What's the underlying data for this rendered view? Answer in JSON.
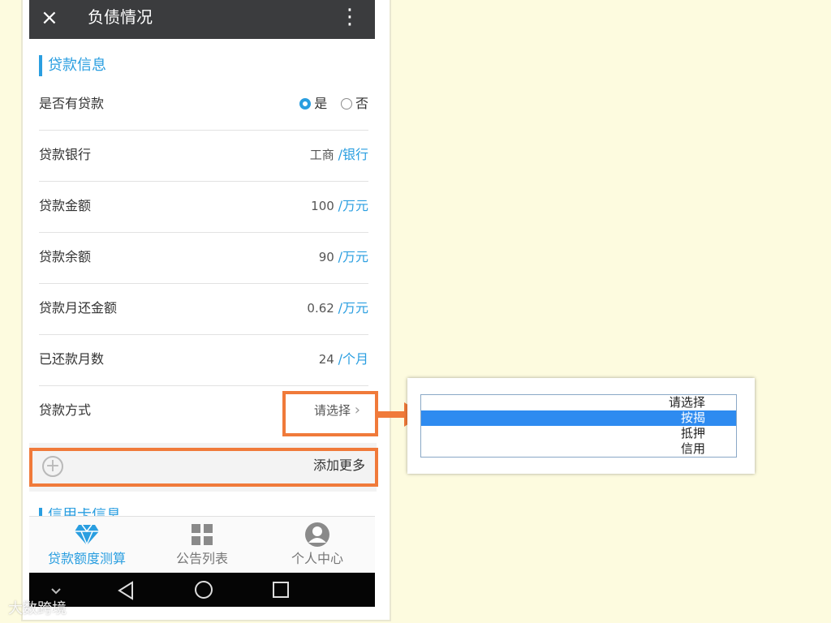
{
  "titlebar": {
    "title": "负债情况",
    "close_icon": "×",
    "more_icon": "⋮"
  },
  "section": {
    "title": "贷款信息"
  },
  "rows": [
    {
      "label": "是否有贷款",
      "options": [
        "是",
        "否"
      ],
      "selected": "是"
    },
    {
      "label": "贷款银行",
      "value": "工商",
      "unit": "/银行"
    },
    {
      "label": "贷款金额",
      "value": "100",
      "unit": "/万元"
    },
    {
      "label": "贷款余额",
      "value": "90",
      "unit": "/万元"
    },
    {
      "label": "贷款月还金额",
      "value": "0.62",
      "unit": "/万元"
    },
    {
      "label": "已还款月数",
      "value": "24",
      "unit": "/个月"
    },
    {
      "label": "贷款方式",
      "value": "请选择",
      "chevron": "›"
    }
  ],
  "add_more": {
    "label": "添加更多",
    "icon": "+"
  },
  "next_section": {
    "title": "信用卡信息"
  },
  "tabs": [
    {
      "label": "贷款额度测算",
      "icon": "diamond-icon",
      "active": true
    },
    {
      "label": "公告列表",
      "icon": "grid-icon",
      "active": false
    },
    {
      "label": "个人中心",
      "icon": "user-icon",
      "active": false
    }
  ],
  "popup": {
    "options": [
      "请选择",
      "按揭",
      "抵押",
      "信用"
    ],
    "selected": "按揭"
  },
  "watermark": "大数跨境",
  "colors": {
    "accent": "#2a9ee0",
    "highlight": "#f07a3a",
    "select_bg": "#2e8bf0",
    "background": "#fdfbdf"
  }
}
